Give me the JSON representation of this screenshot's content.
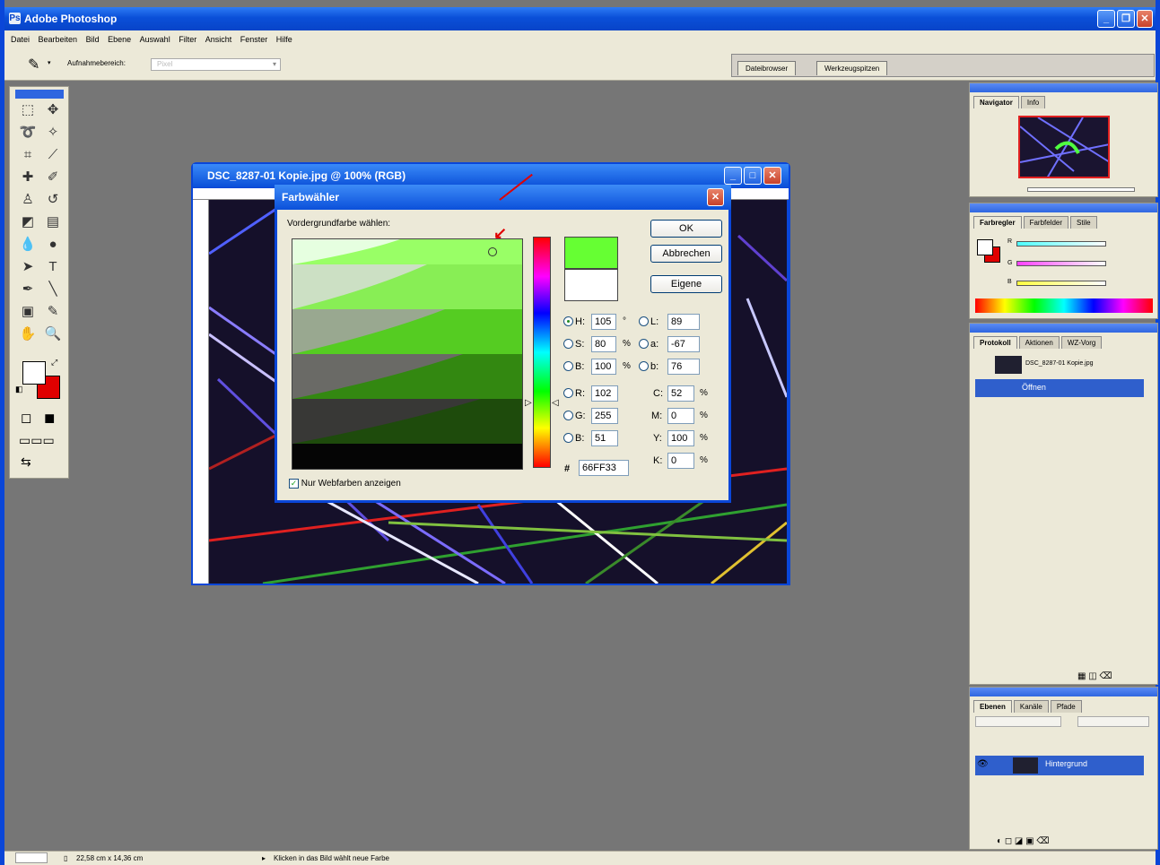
{
  "app": {
    "title": "Adobe Photoshop",
    "logo": "Ps-icon"
  },
  "menu": [
    "Datei",
    "Bearbeiten",
    "Bild",
    "Ebene",
    "Auswahl",
    "Filter",
    "Ansicht",
    "Fenster",
    "Hilfe"
  ],
  "options": {
    "sample_label": "Aufnahmebereich:",
    "sample_value": "Pixel",
    "tabs": [
      "Dateibrowser",
      "Werkzeugspitzen"
    ]
  },
  "document": {
    "title": "DSC_8287-01 Kopie.jpg @ 100% (RGB)"
  },
  "picker": {
    "title": "Farbwähler",
    "prompt": "Vordergrundfarbe wählen:",
    "ok": "OK",
    "cancel": "Abbrechen",
    "custom": "Eigene",
    "web_only": "Nur Webfarben anzeigen",
    "new_color": "#66FF33",
    "old_color": "#FFFFFF",
    "hsb": {
      "h": "105",
      "s": "80",
      "b": "100",
      "h_unit": "°",
      "pct": "%"
    },
    "lab": {
      "l": "89",
      "a": "-67",
      "b": "76"
    },
    "rgb": {
      "r": "102",
      "g": "255",
      "b": "51"
    },
    "cmyk": {
      "c": "52",
      "m": "0",
      "y": "100",
      "k": "0"
    },
    "hex": "66FF33",
    "hash": "#",
    "labels": {
      "H": "H:",
      "S": "S:",
      "B": "B:",
      "L": "L:",
      "a": "a:",
      "bb": "b:",
      "R": "R:",
      "G": "G:",
      "Bl": "B:",
      "C": "C:",
      "M": "M:",
      "Y": "Y:",
      "K": "K:"
    }
  },
  "panels": {
    "nav_tabs": [
      "Navigator",
      "Info"
    ],
    "color_tabs": [
      "Farbregler",
      "Farbfelder",
      "Stile"
    ],
    "color_labels": {
      "r": "R",
      "g": "G",
      "b": "B"
    },
    "history_tabs": [
      "Protokoll",
      "Aktionen",
      "WZ-Vorg"
    ],
    "history_doc": "DSC_8287-01 Kopie.jpg",
    "history_step": "Öffnen",
    "layer_tabs": [
      "Ebenen",
      "Kanäle",
      "Pfade"
    ],
    "layer_name": "Hintergrund"
  },
  "status": {
    "doc_size": "22,58 cm x 14,36 cm",
    "hint": "Klicken in das Bild wählt neue Farbe"
  }
}
